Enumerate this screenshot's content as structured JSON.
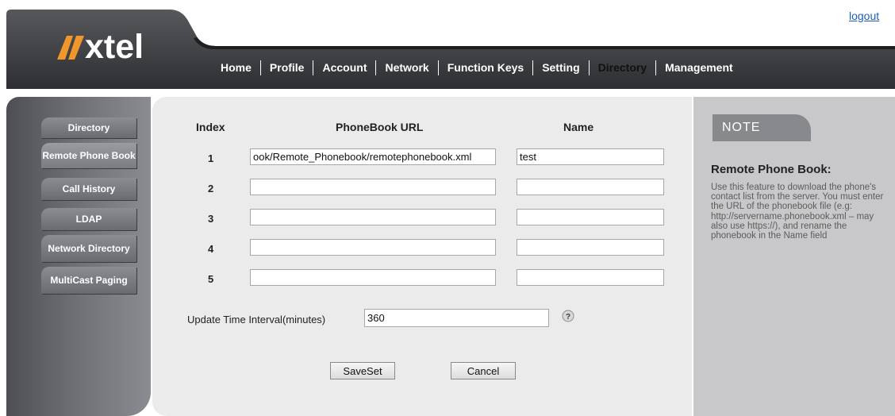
{
  "header": {
    "logout": "logout",
    "brand": "xtel",
    "nav": [
      "Home",
      "Profile",
      "Account",
      "Network",
      "Function Keys",
      "Setting",
      "Directory",
      "Management"
    ],
    "active_nav": "Directory"
  },
  "sidebar": {
    "items": [
      "Directory",
      "Remote Phone Book",
      "Call History",
      "LDAP",
      "Network Directory",
      "MultiCast Paging"
    ],
    "active": "Remote Phone Book"
  },
  "phonebook": {
    "col_index": "Index",
    "col_url": "PhoneBook URL",
    "col_name": "Name",
    "rows": [
      {
        "index": "1",
        "url": "ook/Remote_Phonebook/remotephonebook.xml",
        "name": "test"
      },
      {
        "index": "2",
        "url": "",
        "name": ""
      },
      {
        "index": "3",
        "url": "",
        "name": ""
      },
      {
        "index": "4",
        "url": "",
        "name": ""
      },
      {
        "index": "5",
        "url": "",
        "name": ""
      }
    ]
  },
  "interval": {
    "label": "Update Time Interval(minutes)",
    "value": "360"
  },
  "buttons": {
    "save": "SaveSet",
    "cancel": "Cancel"
  },
  "note": {
    "tab": "NOTE",
    "title": "Remote Phone Book:",
    "body": "Use this feature to download the phone's contact list from the server. You must enter the URL of the phonebook file (e.g: http://servername.phonebook.xml – may also use https://), and rename the phonebook in the Name field"
  },
  "colors": {
    "brand_orange": "#f0962a",
    "header_dark": "#3a3b3e",
    "link_blue": "#1a5fb4"
  }
}
